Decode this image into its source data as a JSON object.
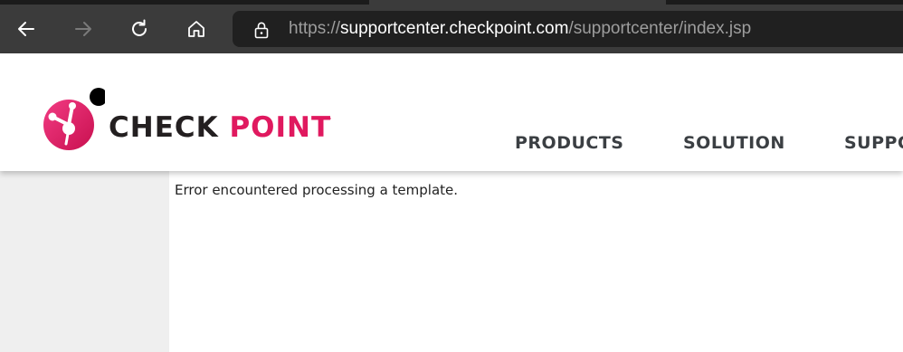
{
  "browser": {
    "url_scheme": "https://",
    "url_host": "supportcenter.checkpoint.com",
    "url_path": "/supportcenter/index.jsp",
    "icons": {
      "back": "back-arrow-icon",
      "forward": "forward-arrow-icon",
      "refresh": "refresh-icon",
      "home": "home-icon",
      "lock": "lock-icon"
    }
  },
  "header": {
    "logo_word1": "CHECK ",
    "logo_word2": "POINT",
    "logo_tm": "™",
    "nav": [
      {
        "label": "PRODUCTS"
      },
      {
        "label": "SOLUTION"
      },
      {
        "label": "SUPPORT"
      }
    ]
  },
  "main": {
    "error_message": "Error encountered processing a template."
  },
  "colors": {
    "brand_pink": "#e0195f",
    "brand_dark": "#231f20",
    "chrome_bg": "#3b3b3b",
    "addressbar_bg": "#202020"
  }
}
